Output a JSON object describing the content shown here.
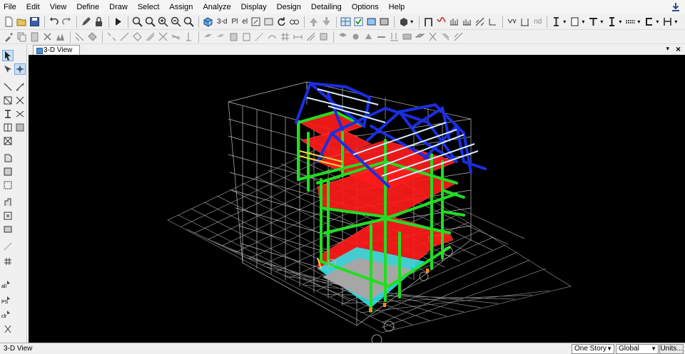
{
  "menu": [
    "File",
    "Edit",
    "View",
    "Define",
    "Draw",
    "Select",
    "Assign",
    "Analyze",
    "Display",
    "Design",
    "Detailing",
    "Options",
    "Help"
  ],
  "toolbar": {
    "view_3d_label": "3-d",
    "plan_label": "Pl",
    "elev_label": "el",
    "nd_label": "nd"
  },
  "window": {
    "tab_title": "3-D View",
    "menu_glyph": "▾",
    "close_glyph": "×"
  },
  "status": {
    "left_text": "3-D View",
    "story_option": "One Story",
    "coord_option": "Global",
    "units_label": "Units..."
  },
  "left_labels": {
    "all": "all",
    "ps": "PS",
    "clr": "clr"
  },
  "colors": {
    "columns": "#22dd22",
    "beams_roof": "#1a2ee0",
    "slabs": "#ff1a1a",
    "foundation": "#33e0e6",
    "grid": "#ffffff",
    "background": "#000000"
  },
  "icons": [
    "new-icon",
    "open-icon",
    "save-icon",
    "undo-icon",
    "redo-icon",
    "pencil-icon",
    "lock-icon",
    "run-icon",
    "zoom-in-icon",
    "zoom-out-icon",
    "pan-icon",
    "rotate-icon",
    "pointer-icon"
  ]
}
